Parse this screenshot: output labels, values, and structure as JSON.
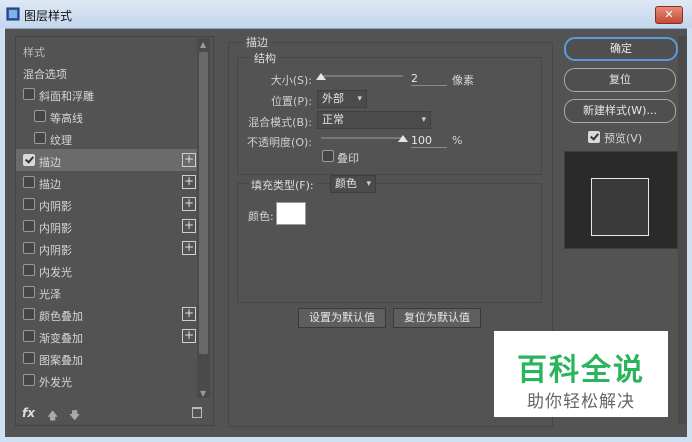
{
  "window": {
    "title": "图层样式",
    "close_label": "✕"
  },
  "style_list": {
    "items": [
      {
        "label": "样式",
        "checkbox": false,
        "checked": false,
        "plus": false,
        "indent": 0,
        "selected": false
      },
      {
        "label": "混合选项",
        "checkbox": false,
        "checked": false,
        "plus": false,
        "indent": 0,
        "selected": false
      },
      {
        "label": "斜面和浮雕",
        "checkbox": true,
        "checked": false,
        "plus": false,
        "indent": 0,
        "selected": false
      },
      {
        "label": "等高线",
        "checkbox": true,
        "checked": false,
        "plus": false,
        "indent": 1,
        "selected": false
      },
      {
        "label": "纹理",
        "checkbox": true,
        "checked": false,
        "plus": false,
        "indent": 1,
        "selected": false
      },
      {
        "label": "描边",
        "checkbox": true,
        "checked": true,
        "plus": true,
        "indent": 0,
        "selected": true
      },
      {
        "label": "描边",
        "checkbox": true,
        "checked": false,
        "plus": true,
        "indent": 0,
        "selected": false
      },
      {
        "label": "内阴影",
        "checkbox": true,
        "checked": false,
        "plus": true,
        "indent": 0,
        "selected": false
      },
      {
        "label": "内阴影",
        "checkbox": true,
        "checked": false,
        "plus": true,
        "indent": 0,
        "selected": false
      },
      {
        "label": "内阴影",
        "checkbox": true,
        "checked": false,
        "plus": true,
        "indent": 0,
        "selected": false
      },
      {
        "label": "内发光",
        "checkbox": true,
        "checked": false,
        "plus": false,
        "indent": 0,
        "selected": false
      },
      {
        "label": "光泽",
        "checkbox": true,
        "checked": false,
        "plus": false,
        "indent": 0,
        "selected": false
      },
      {
        "label": "颜色叠加",
        "checkbox": true,
        "checked": false,
        "plus": true,
        "indent": 0,
        "selected": false
      },
      {
        "label": "渐变叠加",
        "checkbox": true,
        "checked": false,
        "plus": true,
        "indent": 0,
        "selected": false
      },
      {
        "label": "图案叠加",
        "checkbox": true,
        "checked": false,
        "plus": false,
        "indent": 0,
        "selected": false
      },
      {
        "label": "外发光",
        "checkbox": true,
        "checked": false,
        "plus": false,
        "indent": 0,
        "selected": false
      }
    ],
    "fx_label": "fx",
    "up_arrow": "🡅",
    "down_arrow": "🡇"
  },
  "stroke": {
    "section_title": "描边",
    "structure_title": "结构",
    "size_label": "大小(S):",
    "size_value": "2",
    "size_unit": "像素",
    "position_label": "位置(P):",
    "position_value": "外部",
    "blend_label": "混合模式(B):",
    "blend_value": "正常",
    "opacity_label": "不透明度(O):",
    "opacity_value": "100",
    "opacity_unit": "%",
    "opacity_level": 1.0,
    "size_level": 0.0,
    "overprint_label": "叠印",
    "fill_type_label": "填充类型(F):",
    "fill_type_value": "颜色",
    "color_label": "颜色:",
    "color_value": "#ffffff",
    "set_default_label": "设置为默认值",
    "reset_default_label": "复位为默认值"
  },
  "right": {
    "ok_label": "确定",
    "reset_label": "复位",
    "new_style_label": "新建样式(W)...",
    "preview_label": "预览(V)",
    "preview_checked": true
  },
  "watermark": {
    "title": "百科全说",
    "subtitle": "助你轻松解决"
  },
  "colors": {
    "accent": "#5b9bdc",
    "panel": "#535353",
    "watermark_green": "#2ab55c"
  }
}
